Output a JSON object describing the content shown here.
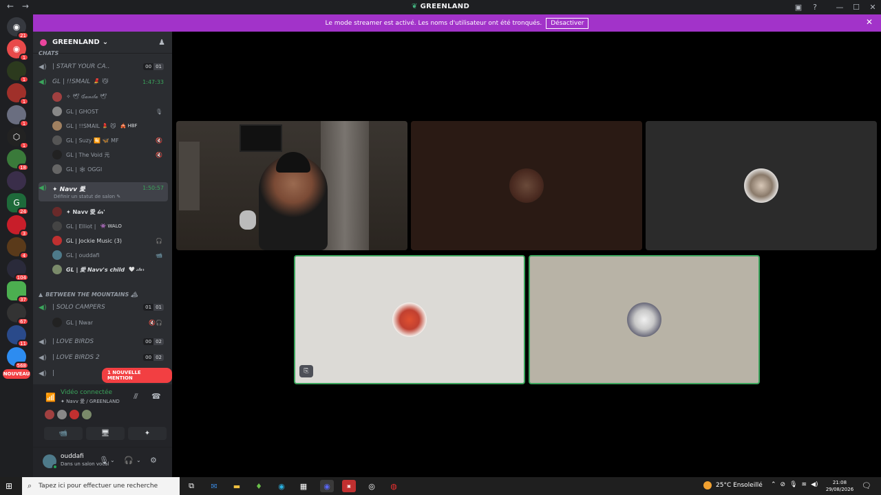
{
  "window": {
    "title": "GREENLAND",
    "nav": [
      "←",
      "→"
    ],
    "tools": [
      "▣",
      "?"
    ],
    "controls": [
      "—",
      "☐",
      "✕"
    ]
  },
  "banner": {
    "text": "Le mode streamer est activé. Les noms d'utilisateur ont été tronqués.",
    "button": "Désactiver",
    "close": "✕"
  },
  "guilds": {
    "badges": [
      "21",
      "1",
      "1",
      "1",
      "1",
      "1",
      "1",
      "18",
      "24",
      "3",
      "4",
      "104",
      "37",
      "67",
      "11",
      "568"
    ],
    "nouveau": "NOUVEAU"
  },
  "server": {
    "name": "GREENLAND",
    "chevron": "⌄"
  },
  "channels": {
    "top_category": "CHATS",
    "start": {
      "label": "| START YOUR CA..",
      "c1": "00",
      "c2": "01"
    },
    "ismail": {
      "label": "GL | !!SMAIL 💄 😼",
      "timer": "1:47:33"
    },
    "ismail_users": [
      {
        "name": "✧ 🕊 ɗ𝒶𝓃𝒾𝓁𝒶 🕊",
        "right": ""
      },
      {
        "name": "GL | GHOST",
        "right": "🎙"
      },
      {
        "name": "GL | !!SMAIL 💄 😼",
        "tag": "🎪 HBF",
        "right": ""
      },
      {
        "name": "GL | Suzy 🈶 🦋 MF",
        "right": "🔇"
      },
      {
        "name": "GL | The Void 元",
        "right": "🔇"
      },
      {
        "name": "GL | 🕸 OGGI",
        "right": ""
      }
    ],
    "navv": {
      "label": "✦ Navv 愛",
      "timer": "1:50:57",
      "status": "Définir un statut de salon ✎"
    },
    "navv_users": [
      {
        "name": "✦ Navv 愛 𝓁𝒾𝓇'",
        "right": ""
      },
      {
        "name": "GL | Elliot |",
        "tag": "👾 WALO",
        "right": ""
      },
      {
        "name": "GL | Jockie Music (3)",
        "right": "🎧"
      },
      {
        "name": "GL | ouddafi",
        "right": "📹"
      },
      {
        "name": "GL | 愛 Navv's child",
        "tag": "🤍 𝓈𝓉𝒶𝓇",
        "right": ""
      }
    ],
    "mountains": "BETWEEN THE MOUNTAINS 🏔",
    "solo": {
      "label": "| SOLO CAMPERS",
      "c1": "01",
      "c2": "01"
    },
    "solo_user": {
      "name": "GL | Nwar",
      "right": "🔇🎧"
    },
    "lovebirds": {
      "label": "| LOVE BIRDS",
      "c1": "00",
      "c2": "02"
    },
    "lovebirds2": {
      "label": "| LOVE BIRDS 2",
      "c1": "00",
      "c2": "02"
    },
    "last": {
      "label": "| "
    },
    "mention": "1 NOUVELLE MENTION"
  },
  "voice": {
    "status": "Vidéo connectée",
    "sub": "✦ Navv 愛 / GREENLAND",
    "buttons": [
      "📹",
      "🖥",
      "✦"
    ]
  },
  "user": {
    "name": "ouddafi",
    "status": "Dans un salon vocal"
  },
  "taskbar": {
    "search_placeholder": "Tapez ici pour effectuer une recherche",
    "weather": "25°C  Ensoleillé",
    "time": "21:08",
    "date": "29/08/2026",
    "notif_count": "5"
  },
  "colors": {
    "accent": "#a233c9",
    "speaking": "#3ba55c",
    "online": "#23a559",
    "danger": "#f23f42"
  }
}
